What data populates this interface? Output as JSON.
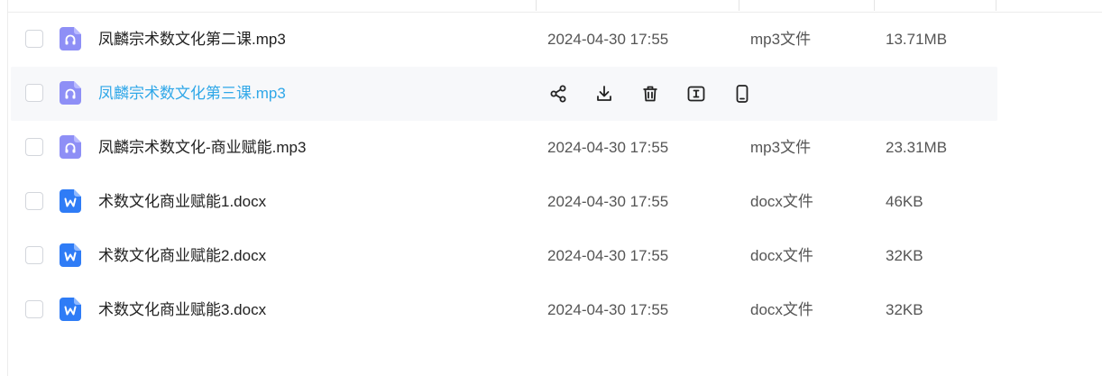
{
  "files": [
    {
      "name": "凤麟宗术数文化第二课.mp3",
      "date": "2024-04-30 17:55",
      "type": "mp3文件",
      "size": "13.71MB",
      "icon": "audio-file-icon",
      "hover": false
    },
    {
      "name": "凤麟宗术数文化第三课.mp3",
      "date": "",
      "type": "",
      "size": "",
      "icon": "audio-file-icon",
      "hover": true
    },
    {
      "name": "凤麟宗术数文化-商业赋能.mp3",
      "date": "2024-04-30 17:55",
      "type": "mp3文件",
      "size": "23.31MB",
      "icon": "audio-file-icon",
      "hover": false
    },
    {
      "name": "术数文化商业赋能1.docx",
      "date": "2024-04-30 17:55",
      "type": "docx文件",
      "size": "46KB",
      "icon": "word-file-icon",
      "hover": false
    },
    {
      "name": "术数文化商业赋能2.docx",
      "date": "2024-04-30 17:55",
      "type": "docx文件",
      "size": "32KB",
      "icon": "word-file-icon",
      "hover": false
    },
    {
      "name": "术数文化商业赋能3.docx",
      "date": "2024-04-30 17:55",
      "type": "docx文件",
      "size": "32KB",
      "icon": "word-file-icon",
      "hover": false
    }
  ],
  "row_actions": [
    "share-icon",
    "download-icon",
    "delete-icon",
    "rename-icon",
    "phone-icon"
  ],
  "colors": {
    "audio_icon": "#8e8ff6",
    "word_icon": "#2f7cf6",
    "hover_name": "#2fa7e8",
    "hover_bg": "#f7f8fa"
  }
}
